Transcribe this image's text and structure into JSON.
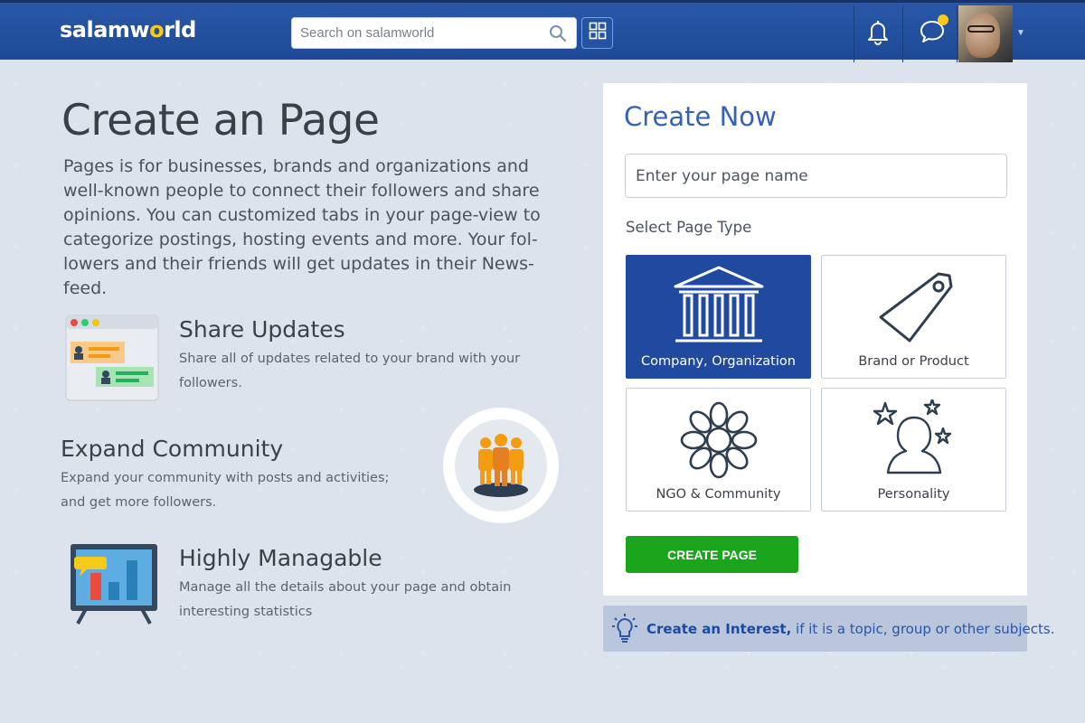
{
  "header": {
    "logo_main": "salamw",
    "logo_accent": "o",
    "logo_end": "rld",
    "search_placeholder": "Search on salamworld"
  },
  "main": {
    "title": "Create an Page",
    "intro": "Pages is for businesses, brands and organizations and well-known people to connect their followers and share opinions. You can customized tabs in your page-view to categorize postings, hosting events and more.  Your fol-lowers  and their friends will get updates in their News-feed.",
    "features": [
      {
        "title": "Share Updates",
        "desc": "Share all of updates related to your brand with your followers."
      },
      {
        "title": "Expand Community",
        "desc": "Expand your community with posts and activities; and get more followers."
      },
      {
        "title": "Highly Managable",
        "desc": "Manage all the details about your page and obtain interesting statistics"
      }
    ]
  },
  "form": {
    "heading": "Create Now",
    "name_placeholder": "Enter your page name",
    "select_label": "Select Page Type",
    "types": [
      {
        "label": "Company, Organization",
        "icon": "building-icon",
        "selected": true
      },
      {
        "label": "Brand or Product",
        "icon": "tag-icon",
        "selected": false
      },
      {
        "label": "NGO & Community",
        "icon": "flower-icon",
        "selected": false
      },
      {
        "label": "Personality",
        "icon": "person-stars-icon",
        "selected": false
      }
    ],
    "submit_label": "CREATE PAGE"
  },
  "interest": {
    "link_text": "Create an Interest,",
    "rest_text": " if it is a topic, group or other subjects."
  },
  "colors": {
    "header_blue": "#1e4a96",
    "accent_yellow": "#f7c91a",
    "selected_tile": "#1f4aa0",
    "create_green": "#1aa51c",
    "heading_blue": "#3561b6"
  }
}
